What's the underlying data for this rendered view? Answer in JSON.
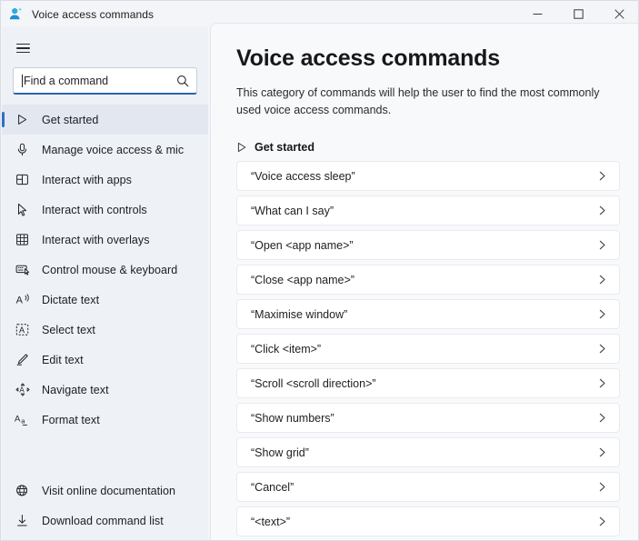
{
  "window": {
    "title": "Voice access commands",
    "app_icon": "voice-access-person-icon",
    "controls": {
      "minimize": "minimize-icon",
      "maximize": "maximize-icon",
      "close": "close-icon"
    }
  },
  "sidebar": {
    "menu_icon": "hamburger-menu-icon",
    "search": {
      "placeholder": "Find a command",
      "value": "",
      "icon": "search-icon"
    },
    "items": [
      {
        "label": "Get started",
        "icon": "play-triangle-icon",
        "selected": true
      },
      {
        "label": "Manage voice access & mic",
        "icon": "microphone-icon",
        "selected": false
      },
      {
        "label": "Interact with apps",
        "icon": "apps-grid-icon",
        "selected": false
      },
      {
        "label": "Interact with controls",
        "icon": "cursor-arrow-icon",
        "selected": false
      },
      {
        "label": "Interact with overlays",
        "icon": "grid-overlay-icon",
        "selected": false
      },
      {
        "label": "Control mouse & keyboard",
        "icon": "keyboard-mouse-icon",
        "selected": false
      },
      {
        "label": "Dictate text",
        "icon": "dictate-a-icon",
        "selected": false
      },
      {
        "label": "Select text",
        "icon": "select-a-box-icon",
        "selected": false
      },
      {
        "label": "Edit text",
        "icon": "edit-pencil-icon",
        "selected": false
      },
      {
        "label": "Navigate text",
        "icon": "navigate-a-arrows-icon",
        "selected": false
      },
      {
        "label": "Format text",
        "icon": "format-aa-icon",
        "selected": false
      }
    ],
    "bottom_items": [
      {
        "label": "Visit online documentation",
        "icon": "globe-icon"
      },
      {
        "label": "Download command list",
        "icon": "download-icon"
      }
    ]
  },
  "main": {
    "title": "Voice access commands",
    "description": "This category of commands will help the user to find the most commonly used voice access commands.",
    "section": {
      "icon": "play-triangle-icon",
      "title": "Get started"
    },
    "commands": [
      {
        "label": "“Voice access sleep”",
        "chevron": "chevron-right-icon"
      },
      {
        "label": "“What can I say”",
        "chevron": "chevron-right-icon"
      },
      {
        "label": "“Open  <app name>”",
        "chevron": "chevron-right-icon"
      },
      {
        "label": "“Close <app name>”",
        "chevron": "chevron-right-icon"
      },
      {
        "label": "“Maximise window”",
        "chevron": "chevron-right-icon"
      },
      {
        "label": "“Click <item>”",
        "chevron": "chevron-right-icon"
      },
      {
        "label": "“Scroll <scroll direction>”",
        "chevron": "chevron-right-icon"
      },
      {
        "label": "“Show numbers”",
        "chevron": "chevron-right-icon"
      },
      {
        "label": "“Show grid”",
        "chevron": "chevron-right-icon"
      },
      {
        "label": "“Cancel”",
        "chevron": "chevron-right-icon"
      },
      {
        "label": "“<text>”",
        "chevron": "chevron-right-icon"
      }
    ]
  },
  "colors": {
    "accent": "#2f6fc4",
    "sidebar_bg": "#eef1f6",
    "main_bg": "#f8f9fb",
    "row_bg": "#ffffff"
  }
}
